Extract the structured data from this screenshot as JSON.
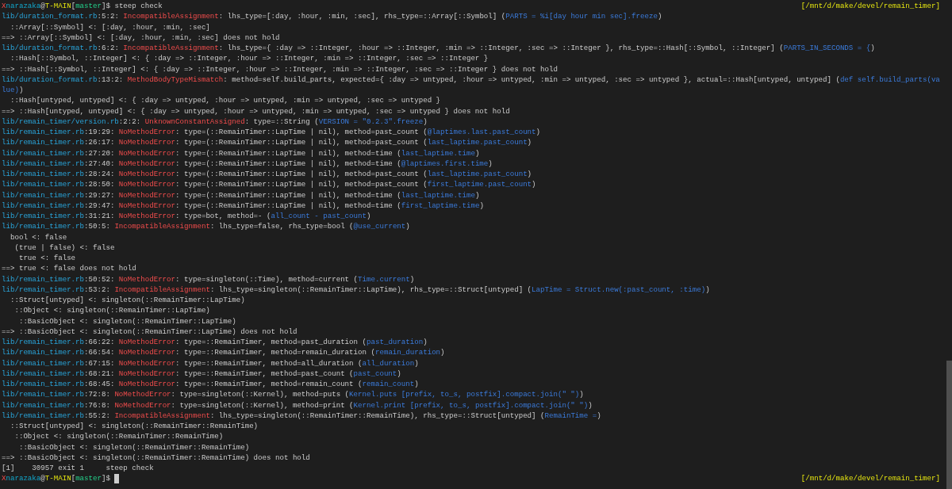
{
  "terminal": {
    "lines": [
      {
        "kind": "prompt",
        "cursor": false,
        "cwd": "[/mnt/d/make/devel/remain_timer]",
        "segments": [
          {
            "kind": "mark",
            "text": "X"
          },
          {
            "kind": "user",
            "text": "narazaka"
          },
          {
            "kind": "text",
            "text": "@"
          },
          {
            "kind": "host",
            "text": "T-MAIN"
          },
          {
            "kind": "text",
            "text": "["
          },
          {
            "kind": "branch",
            "text": "master"
          },
          {
            "kind": "text",
            "text": "]$ steep check"
          }
        ]
      },
      {
        "kind": "output",
        "segments": [
          {
            "kind": "file",
            "text": "lib/duration_format.rb"
          },
          {
            "kind": "text",
            "text": ":5:2: "
          },
          {
            "kind": "error",
            "text": "IncompatibleAssignment"
          },
          {
            "kind": "text",
            "text": ": lhs_type=[:day, :hour, :min, :sec], rhs_type=::Array[::Symbol] ("
          },
          {
            "kind": "code",
            "text": "PARTS = %i[day hour min sec].freeze"
          },
          {
            "kind": "text",
            "text": ")"
          }
        ]
      },
      {
        "kind": "output",
        "segments": [
          {
            "kind": "text",
            "text": "  ::Array[::Symbol] <: [:day, :hour, :min, :sec]"
          }
        ]
      },
      {
        "kind": "output",
        "segments": [
          {
            "kind": "text",
            "text": "==> ::Array[::Symbol] <: [:day, :hour, :min, :sec] does not hold"
          }
        ]
      },
      {
        "kind": "output",
        "segments": [
          {
            "kind": "file",
            "text": "lib/duration_format.rb"
          },
          {
            "kind": "text",
            "text": ":6:2: "
          },
          {
            "kind": "error",
            "text": "IncompatibleAssignment"
          },
          {
            "kind": "text",
            "text": ": lhs_type={ :day => ::Integer, :hour => ::Integer, :min => ::Integer, :sec => ::Integer }, rhs_type=::Hash[::Symbol, ::Integer] ("
          },
          {
            "kind": "code",
            "text": "PARTS_IN_SECONDS = {"
          },
          {
            "kind": "text",
            "text": ")"
          }
        ]
      },
      {
        "kind": "output",
        "segments": [
          {
            "kind": "text",
            "text": "  ::Hash[::Symbol, ::Integer] <: { :day => ::Integer, :hour => ::Integer, :min => ::Integer, :sec => ::Integer }"
          }
        ]
      },
      {
        "kind": "output",
        "segments": [
          {
            "kind": "text",
            "text": "==> ::Hash[::Symbol, ::Integer] <: { :day => ::Integer, :hour => ::Integer, :min => ::Integer, :sec => ::Integer } does not hold"
          }
        ]
      },
      {
        "kind": "output",
        "segments": [
          {
            "kind": "file",
            "text": "lib/duration_format.rb"
          },
          {
            "kind": "text",
            "text": ":13:2: "
          },
          {
            "kind": "error",
            "text": "MethodBodyTypeMismatch"
          },
          {
            "kind": "text",
            "text": ": method=self.build_parts, expected={ :day => untyped, :hour => untyped, :min => untyped, :sec => untyped }, actual=::Hash[untyped, untyped] ("
          },
          {
            "kind": "code",
            "text": "def self.build_parts(va"
          }
        ]
      },
      {
        "kind": "output",
        "segments": [
          {
            "kind": "code",
            "text": "lue)"
          },
          {
            "kind": "text",
            "text": ")"
          }
        ]
      },
      {
        "kind": "output",
        "segments": [
          {
            "kind": "text",
            "text": "  ::Hash[untyped, untyped] <: { :day => untyped, :hour => untyped, :min => untyped, :sec => untyped }"
          }
        ]
      },
      {
        "kind": "output",
        "segments": [
          {
            "kind": "text",
            "text": "==> ::Hash[untyped, untyped] <: { :day => untyped, :hour => untyped, :min => untyped, :sec => untyped } does not hold"
          }
        ]
      },
      {
        "kind": "output",
        "segments": [
          {
            "kind": "file",
            "text": "lib/remain_timer/version.rb"
          },
          {
            "kind": "text",
            "text": ":2:2: "
          },
          {
            "kind": "error",
            "text": "UnknownConstantAssigned"
          },
          {
            "kind": "text",
            "text": ": type=::String ("
          },
          {
            "kind": "code",
            "text": "VERSION = \"0.2.3\".freeze"
          },
          {
            "kind": "text",
            "text": ")"
          }
        ]
      },
      {
        "kind": "output",
        "segments": [
          {
            "kind": "file",
            "text": "lib/remain_timer.rb"
          },
          {
            "kind": "text",
            "text": ":19:29: "
          },
          {
            "kind": "error",
            "text": "NoMethodError"
          },
          {
            "kind": "text",
            "text": ": type=(::RemainTimer::LapTime | nil), method=past_count ("
          },
          {
            "kind": "code",
            "text": "@laptimes.last.past_count"
          },
          {
            "kind": "text",
            "text": ")"
          }
        ]
      },
      {
        "kind": "output",
        "segments": [
          {
            "kind": "file",
            "text": "lib/remain_timer.rb"
          },
          {
            "kind": "text",
            "text": ":26:17: "
          },
          {
            "kind": "error",
            "text": "NoMethodError"
          },
          {
            "kind": "text",
            "text": ": type=(::RemainTimer::LapTime | nil), method=past_count ("
          },
          {
            "kind": "code",
            "text": "last_laptime.past_count"
          },
          {
            "kind": "text",
            "text": ")"
          }
        ]
      },
      {
        "kind": "output",
        "segments": [
          {
            "kind": "file",
            "text": "lib/remain_timer.rb"
          },
          {
            "kind": "text",
            "text": ":27:20: "
          },
          {
            "kind": "error",
            "text": "NoMethodError"
          },
          {
            "kind": "text",
            "text": ": type=(::RemainTimer::LapTime | nil), method=time ("
          },
          {
            "kind": "code",
            "text": "last_laptime.time"
          },
          {
            "kind": "text",
            "text": ")"
          }
        ]
      },
      {
        "kind": "output",
        "segments": [
          {
            "kind": "file",
            "text": "lib/remain_timer.rb"
          },
          {
            "kind": "text",
            "text": ":27:40: "
          },
          {
            "kind": "error",
            "text": "NoMethodError"
          },
          {
            "kind": "text",
            "text": ": type=(::RemainTimer::LapTime | nil), method=time ("
          },
          {
            "kind": "code",
            "text": "@laptimes.first.time"
          },
          {
            "kind": "text",
            "text": ")"
          }
        ]
      },
      {
        "kind": "output",
        "segments": [
          {
            "kind": "file",
            "text": "lib/remain_timer.rb"
          },
          {
            "kind": "text",
            "text": ":28:24: "
          },
          {
            "kind": "error",
            "text": "NoMethodError"
          },
          {
            "kind": "text",
            "text": ": type=(::RemainTimer::LapTime | nil), method=past_count ("
          },
          {
            "kind": "code",
            "text": "last_laptime.past_count"
          },
          {
            "kind": "text",
            "text": ")"
          }
        ]
      },
      {
        "kind": "output",
        "segments": [
          {
            "kind": "file",
            "text": "lib/remain_timer.rb"
          },
          {
            "kind": "text",
            "text": ":28:50: "
          },
          {
            "kind": "error",
            "text": "NoMethodError"
          },
          {
            "kind": "text",
            "text": ": type=(::RemainTimer::LapTime | nil), method=past_count ("
          },
          {
            "kind": "code",
            "text": "first_laptime.past_count"
          },
          {
            "kind": "text",
            "text": ")"
          }
        ]
      },
      {
        "kind": "output",
        "segments": [
          {
            "kind": "file",
            "text": "lib/remain_timer.rb"
          },
          {
            "kind": "text",
            "text": ":29:27: "
          },
          {
            "kind": "error",
            "text": "NoMethodError"
          },
          {
            "kind": "text",
            "text": ": type=(::RemainTimer::LapTime | nil), method=time ("
          },
          {
            "kind": "code",
            "text": "last_laptime.time"
          },
          {
            "kind": "text",
            "text": ")"
          }
        ]
      },
      {
        "kind": "output",
        "segments": [
          {
            "kind": "file",
            "text": "lib/remain_timer.rb"
          },
          {
            "kind": "text",
            "text": ":29:47: "
          },
          {
            "kind": "error",
            "text": "NoMethodError"
          },
          {
            "kind": "text",
            "text": ": type=(::RemainTimer::LapTime | nil), method=time ("
          },
          {
            "kind": "code",
            "text": "first_laptime.time"
          },
          {
            "kind": "text",
            "text": ")"
          }
        ]
      },
      {
        "kind": "output",
        "segments": [
          {
            "kind": "file",
            "text": "lib/remain_timer.rb"
          },
          {
            "kind": "text",
            "text": ":31:21: "
          },
          {
            "kind": "error",
            "text": "NoMethodError"
          },
          {
            "kind": "text",
            "text": ": type=bot, method=- ("
          },
          {
            "kind": "code",
            "text": "all_count - past_count"
          },
          {
            "kind": "text",
            "text": ")"
          }
        ]
      },
      {
        "kind": "output",
        "segments": [
          {
            "kind": "file",
            "text": "lib/remain_timer.rb"
          },
          {
            "kind": "text",
            "text": ":50:5: "
          },
          {
            "kind": "error",
            "text": "IncompatibleAssignment"
          },
          {
            "kind": "text",
            "text": ": lhs_type=false, rhs_type=bool ("
          },
          {
            "kind": "code",
            "text": "@use_current"
          },
          {
            "kind": "text",
            "text": ")"
          }
        ]
      },
      {
        "kind": "output",
        "segments": [
          {
            "kind": "text",
            "text": "  bool <: false"
          }
        ]
      },
      {
        "kind": "output",
        "segments": [
          {
            "kind": "text",
            "text": "   (true | false) <: false"
          }
        ]
      },
      {
        "kind": "output",
        "segments": [
          {
            "kind": "text",
            "text": "    true <: false"
          }
        ]
      },
      {
        "kind": "output",
        "segments": [
          {
            "kind": "text",
            "text": "==> true <: false does not hold"
          }
        ]
      },
      {
        "kind": "output",
        "segments": [
          {
            "kind": "file",
            "text": "lib/remain_timer.rb"
          },
          {
            "kind": "text",
            "text": ":50:52: "
          },
          {
            "kind": "error",
            "text": "NoMethodError"
          },
          {
            "kind": "text",
            "text": ": type=singleton(::Time), method=current ("
          },
          {
            "kind": "code",
            "text": "Time.current"
          },
          {
            "kind": "text",
            "text": ")"
          }
        ]
      },
      {
        "kind": "output",
        "segments": [
          {
            "kind": "file",
            "text": "lib/remain_timer.rb"
          },
          {
            "kind": "text",
            "text": ":53:2: "
          },
          {
            "kind": "error",
            "text": "IncompatibleAssignment"
          },
          {
            "kind": "text",
            "text": ": lhs_type=singleton(::RemainTimer::LapTime), rhs_type=::Struct[untyped] ("
          },
          {
            "kind": "code",
            "text": "LapTime = Struct.new(:past_count, :time)"
          },
          {
            "kind": "text",
            "text": ")"
          }
        ]
      },
      {
        "kind": "output",
        "segments": [
          {
            "kind": "text",
            "text": "  ::Struct[untyped] <: singleton(::RemainTimer::LapTime)"
          }
        ]
      },
      {
        "kind": "output",
        "segments": [
          {
            "kind": "text",
            "text": "   ::Object <: singleton(::RemainTimer::LapTime)"
          }
        ]
      },
      {
        "kind": "output",
        "segments": [
          {
            "kind": "text",
            "text": "    ::BasicObject <: singleton(::RemainTimer::LapTime)"
          }
        ]
      },
      {
        "kind": "output",
        "segments": [
          {
            "kind": "text",
            "text": "==> ::BasicObject <: singleton(::RemainTimer::LapTime) does not hold"
          }
        ]
      },
      {
        "kind": "output",
        "segments": [
          {
            "kind": "file",
            "text": "lib/remain_timer.rb"
          },
          {
            "kind": "text",
            "text": ":66:22: "
          },
          {
            "kind": "error",
            "text": "NoMethodError"
          },
          {
            "kind": "text",
            "text": ": type=::RemainTimer, method=past_duration ("
          },
          {
            "kind": "code",
            "text": "past_duration"
          },
          {
            "kind": "text",
            "text": ")"
          }
        ]
      },
      {
        "kind": "output",
        "segments": [
          {
            "kind": "file",
            "text": "lib/remain_timer.rb"
          },
          {
            "kind": "text",
            "text": ":66:54: "
          },
          {
            "kind": "error",
            "text": "NoMethodError"
          },
          {
            "kind": "text",
            "text": ": type=::RemainTimer, method=remain_duration ("
          },
          {
            "kind": "code",
            "text": "remain_duration"
          },
          {
            "kind": "text",
            "text": ")"
          }
        ]
      },
      {
        "kind": "output",
        "segments": [
          {
            "kind": "file",
            "text": "lib/remain_timer.rb"
          },
          {
            "kind": "text",
            "text": ":67:15: "
          },
          {
            "kind": "error",
            "text": "NoMethodError"
          },
          {
            "kind": "text",
            "text": ": type=::RemainTimer, method=all_duration ("
          },
          {
            "kind": "code",
            "text": "all_duration"
          },
          {
            "kind": "text",
            "text": ")"
          }
        ]
      },
      {
        "kind": "output",
        "segments": [
          {
            "kind": "file",
            "text": "lib/remain_timer.rb"
          },
          {
            "kind": "text",
            "text": ":68:21: "
          },
          {
            "kind": "error",
            "text": "NoMethodError"
          },
          {
            "kind": "text",
            "text": ": type=::RemainTimer, method=past_count ("
          },
          {
            "kind": "code",
            "text": "past_count"
          },
          {
            "kind": "text",
            "text": ")"
          }
        ]
      },
      {
        "kind": "output",
        "segments": [
          {
            "kind": "file",
            "text": "lib/remain_timer.rb"
          },
          {
            "kind": "text",
            "text": ":68:45: "
          },
          {
            "kind": "error",
            "text": "NoMethodError"
          },
          {
            "kind": "text",
            "text": ": type=::RemainTimer, method=remain_count ("
          },
          {
            "kind": "code",
            "text": "remain_count"
          },
          {
            "kind": "text",
            "text": ")"
          }
        ]
      },
      {
        "kind": "output",
        "segments": [
          {
            "kind": "file",
            "text": "lib/remain_timer.rb"
          },
          {
            "kind": "text",
            "text": ":72:8: "
          },
          {
            "kind": "error",
            "text": "NoMethodError"
          },
          {
            "kind": "text",
            "text": ": type=singleton(::Kernel), method=puts ("
          },
          {
            "kind": "code",
            "text": "Kernel.puts [prefix, to_s, postfix].compact.join(\" \")"
          },
          {
            "kind": "text",
            "text": ")"
          }
        ]
      },
      {
        "kind": "output",
        "segments": [
          {
            "kind": "file",
            "text": "lib/remain_timer.rb"
          },
          {
            "kind": "text",
            "text": ":76:8: "
          },
          {
            "kind": "error",
            "text": "NoMethodError"
          },
          {
            "kind": "text",
            "text": ": type=singleton(::Kernel), method=print ("
          },
          {
            "kind": "code",
            "text": "Kernel.print [prefix, to_s, postfix].compact.join(\" \")"
          },
          {
            "kind": "text",
            "text": ")"
          }
        ]
      },
      {
        "kind": "output",
        "segments": [
          {
            "kind": "file",
            "text": "lib/remain_timer.rb"
          },
          {
            "kind": "text",
            "text": ":55:2: "
          },
          {
            "kind": "error",
            "text": "IncompatibleAssignment"
          },
          {
            "kind": "text",
            "text": ": lhs_type=singleton(::RemainTimer::RemainTime), rhs_type=::Struct[untyped] ("
          },
          {
            "kind": "code",
            "text": "RemainTime ="
          },
          {
            "kind": "text",
            "text": ")"
          }
        ]
      },
      {
        "kind": "output",
        "segments": [
          {
            "kind": "text",
            "text": "  ::Struct[untyped] <: singleton(::RemainTimer::RemainTime)"
          }
        ]
      },
      {
        "kind": "output",
        "segments": [
          {
            "kind": "text",
            "text": "   ::Object <: singleton(::RemainTimer::RemainTime)"
          }
        ]
      },
      {
        "kind": "output",
        "segments": [
          {
            "kind": "text",
            "text": "    ::BasicObject <: singleton(::RemainTimer::RemainTime)"
          }
        ]
      },
      {
        "kind": "output",
        "segments": [
          {
            "kind": "text",
            "text": "==> ::BasicObject <: singleton(::RemainTimer::RemainTime) does not hold"
          }
        ]
      },
      {
        "kind": "output",
        "segments": [
          {
            "kind": "text",
            "text": "[1]    30957 exit 1     steep check"
          }
        ]
      },
      {
        "kind": "prompt",
        "cursor": true,
        "cwd": "[/mnt/d/make/devel/remain_timer]",
        "segments": [
          {
            "kind": "mark",
            "text": "X"
          },
          {
            "kind": "user",
            "text": "narazaka"
          },
          {
            "kind": "text",
            "text": "@"
          },
          {
            "kind": "host",
            "text": "T-MAIN"
          },
          {
            "kind": "text",
            "text": "["
          },
          {
            "kind": "branch",
            "text": "master"
          },
          {
            "kind": "text",
            "text": "]$ "
          }
        ]
      }
    ]
  }
}
